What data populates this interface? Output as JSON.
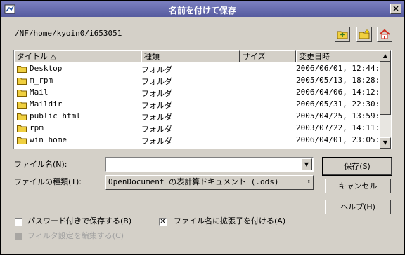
{
  "dialog": {
    "title": "名前を付けて保存"
  },
  "path": "/NF/home/kyoin0/i653051",
  "columns": [
    {
      "label": "タイトル △"
    },
    {
      "label": "種類"
    },
    {
      "label": "サイズ"
    },
    {
      "label": "変更日時"
    }
  ],
  "files": [
    {
      "name": "Desktop",
      "type": "フォルダ",
      "size": "",
      "date": "2006/06/01, 12:44:"
    },
    {
      "name": "m_rpm",
      "type": "フォルダ",
      "size": "",
      "date": "2005/05/13, 18:28:"
    },
    {
      "name": "Mail",
      "type": "フォルダ",
      "size": "",
      "date": "2006/04/06, 14:12:"
    },
    {
      "name": "Maildir",
      "type": "フォルダ",
      "size": "",
      "date": "2006/05/31, 22:30:"
    },
    {
      "name": "public_html",
      "type": "フォルダ",
      "size": "",
      "date": "2005/04/25, 13:59:"
    },
    {
      "name": "rpm",
      "type": "フォルダ",
      "size": "",
      "date": "2003/07/22, 14:11:"
    },
    {
      "name": "win_home",
      "type": "フォルダ",
      "size": "",
      "date": "2006/04/01, 23:05:"
    }
  ],
  "form": {
    "filename_label": "ファイル名(N):",
    "filename_value": "",
    "filetype_label": "ファイルの種類(T):",
    "filetype_value": "OpenDocument の表計算ドキュメント (.ods)"
  },
  "buttons": {
    "save": "保存(S)",
    "cancel": "キャンセル",
    "help": "ヘルプ(H)"
  },
  "options": {
    "password_label": "パスワード付きで保存する(B)",
    "password_checked": false,
    "extension_label": "ファイル名に拡張子を付ける(A)",
    "extension_checked": true,
    "filter_label": "フィルタ設定を編集する(C)",
    "filter_enabled": false
  },
  "colors": {
    "title_bar": "#565b9f",
    "folder": "#f0d040",
    "home_icon": "#d03020"
  },
  "icons": [
    "up-folder-icon",
    "new-folder-icon",
    "home-icon",
    "folder-icon",
    "close-icon"
  ]
}
